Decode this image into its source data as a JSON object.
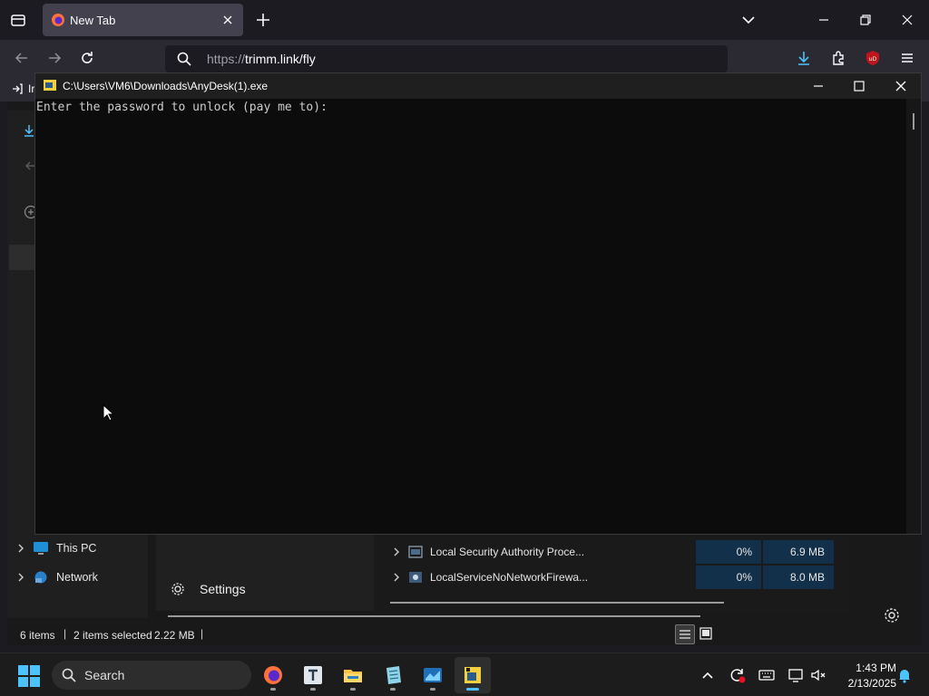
{
  "browser": {
    "tab_title": "New Tab",
    "url_scheme": "https://",
    "url_rest": "trimm.link/fly",
    "bookmark_partial": "Ir"
  },
  "explorer": {
    "nav_items": [
      {
        "label": "This PC",
        "icon": "this-pc-icon"
      },
      {
        "label": "Network",
        "icon": "network-icon"
      }
    ],
    "status": {
      "items": "6 items",
      "selected": "2 items selected",
      "size": "2.22 MB"
    }
  },
  "settings_panel": {
    "label": "Settings"
  },
  "processes": [
    {
      "name": "Local Security Authority Proce...",
      "cpu": "0%",
      "memory": "6.9 MB"
    },
    {
      "name": "LocalServiceNoNetworkFirewa...",
      "cpu": "0%",
      "memory": "8.0 MB"
    }
  ],
  "console": {
    "title": "C:\\Users\\VM6\\Downloads\\AnyDesk(1).exe",
    "output": "Enter the password to unlock (pay me to):"
  },
  "taskbar": {
    "search_label": "Search",
    "apps": [
      "firefox-icon",
      "typora-icon",
      "file-explorer-icon",
      "notepad-icon",
      "task-manager-icon",
      "python-console-icon"
    ],
    "time": "1:43 PM",
    "date": "2/13/2025"
  },
  "colors": {
    "accent": "#4cc2ff",
    "console_bg": "#0c0c0c",
    "console_text": "#cccccc",
    "ublock_red": "#c0161b"
  }
}
